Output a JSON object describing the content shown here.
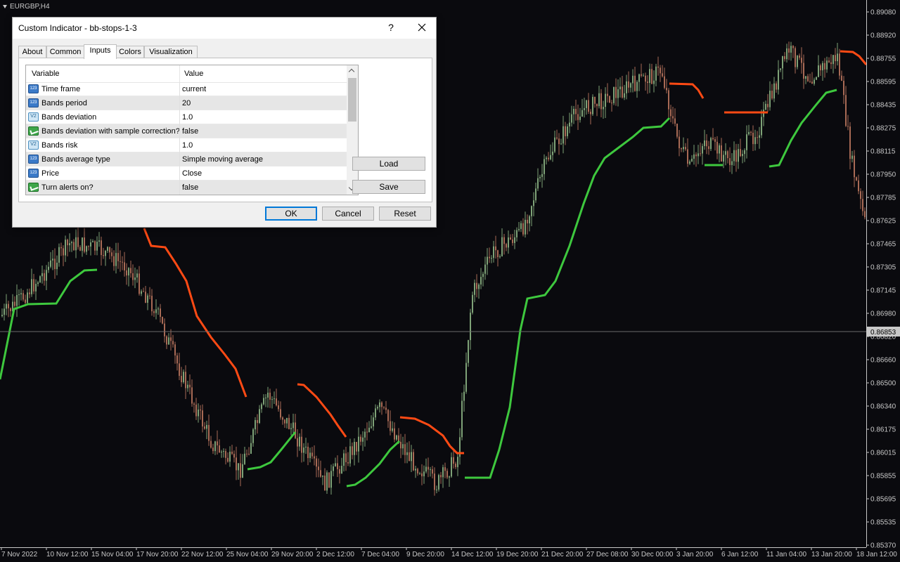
{
  "chart": {
    "symbol": "EURGBP,H4",
    "current_price": "0.86853",
    "price_axis": [
      "0.89080",
      "0.88920",
      "0.88755",
      "0.88595",
      "0.88435",
      "0.88275",
      "0.88115",
      "0.87950",
      "0.87785",
      "0.87625",
      "0.87465",
      "0.87305",
      "0.87145",
      "0.86980",
      "0.86820",
      "0.86660",
      "0.86500",
      "0.86340",
      "0.86175",
      "0.86015",
      "0.85855",
      "0.85695",
      "0.85535",
      "0.85370"
    ],
    "time_axis": [
      "7 Nov 2022",
      "10 Nov 12:00",
      "15 Nov 04:00",
      "17 Nov 20:00",
      "22 Nov 12:00",
      "25 Nov 04:00",
      "29 Nov 20:00",
      "2 Dec 12:00",
      "7 Dec 04:00",
      "9 Dec 20:00",
      "14 Dec 12:00",
      "19 Dec 20:00",
      "21 Dec 20:00",
      "27 Dec 08:00",
      "30 Dec 00:00",
      "3 Jan 20:00",
      "6 Jan 12:00",
      "11 Jan 04:00",
      "13 Jan 20:00",
      "18 Jan 12:00"
    ],
    "colors": {
      "bull": "#7ea277",
      "bear": "#a86a55",
      "stop_up": "#3ec83e",
      "stop_down": "#ff4a14",
      "background": "#0a0a0e",
      "axis_text": "#c8c8c8"
    }
  },
  "dialog": {
    "title": "Custom Indicator - bb-stops-1-3",
    "help": "?",
    "tabs": [
      {
        "label": "About"
      },
      {
        "label": "Common"
      },
      {
        "label": "Inputs"
      },
      {
        "label": "Colors"
      },
      {
        "label": "Visualization"
      }
    ],
    "active_tab": "Inputs",
    "grid": {
      "col_variable": "Variable",
      "col_value": "Value",
      "rows": [
        {
          "icon": "integer-param-icon",
          "name": "Time frame",
          "value": "current"
        },
        {
          "icon": "integer-param-icon",
          "name": "Bands period",
          "value": "20"
        },
        {
          "icon": "double-param-icon",
          "name": "Bands deviation",
          "value": "1.0"
        },
        {
          "icon": "bool-param-icon",
          "name": "Bands deviation with sample correction?",
          "value": "false"
        },
        {
          "icon": "double-param-icon",
          "name": "Bands risk",
          "value": "1.0"
        },
        {
          "icon": "integer-param-icon",
          "name": "Bands average type",
          "value": "Simple moving average"
        },
        {
          "icon": "integer-param-icon",
          "name": "Price",
          "value": "Close"
        },
        {
          "icon": "bool-param-icon",
          "name": "Turn alerts on?",
          "value": "false"
        }
      ]
    },
    "buttons": {
      "load": "Load",
      "save": "Save",
      "ok": "OK",
      "cancel": "Cancel",
      "reset": "Reset"
    }
  }
}
